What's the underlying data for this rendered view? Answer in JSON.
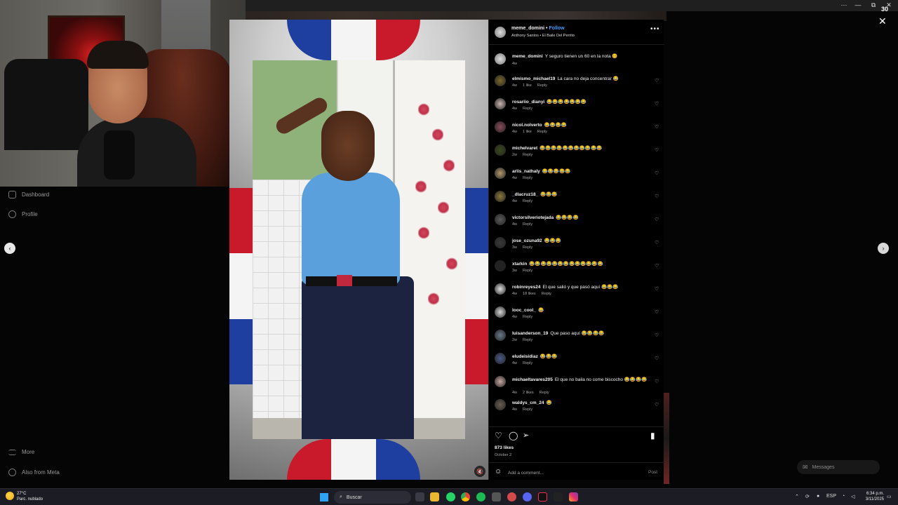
{
  "browser": {
    "controls": [
      "⋯",
      "—",
      "⧉",
      "✕"
    ],
    "counter": "30"
  },
  "sidebar": {
    "items": [
      {
        "label": "Dashboard",
        "icon": "dashboard-icon"
      },
      {
        "label": "Profile",
        "icon": "profile-icon"
      },
      {
        "label": "More",
        "icon": "menu-icon"
      },
      {
        "label": "Also from Meta",
        "icon": "meta-icon"
      }
    ]
  },
  "post": {
    "username": "meme_domini",
    "separator": "•",
    "follow_label": "Follow",
    "audio": "Anthony Santos • El Baile Del Perrito",
    "more_label": "•••",
    "caption": {
      "user": "meme_domini",
      "text": "Y seguro tienen un 60 en la nota 🥴",
      "time": "4w"
    },
    "likes": "873 likes",
    "date": "October 2",
    "add_comment_placeholder": "Add a comment...",
    "post_label": "Post",
    "mute_icon": "🔇"
  },
  "comments": [
    {
      "user": "elmismo_michael19",
      "text": "La cara no deja concentrar 😂",
      "meta": [
        "4w",
        "1 like",
        "Reply"
      ],
      "color": "#7a6a2a"
    },
    {
      "user": "rosariio_dianyi",
      "text": "😂😂😂😂😂😂😂",
      "meta": [
        "4w",
        "Reply"
      ],
      "color": "#c9b7b0"
    },
    {
      "user": "nicol.nolverto",
      "text": "😂😂😂😂",
      "meta": [
        "4w",
        "1 like",
        "Reply"
      ],
      "color": "#8a4a5a"
    },
    {
      "user": "michelvaret",
      "text": "😂😂😂😂😂😂😂😂😂😂😂",
      "meta": [
        "2w",
        "Reply"
      ],
      "color": "#3a4a1a"
    },
    {
      "user": "arlis_nathaly",
      "text": "😂😂😂😂😂",
      "meta": [
        "4w",
        "Reply"
      ],
      "color": "#b59a6a"
    },
    {
      "user": "_dlacruz18_",
      "text": "😂😂😂",
      "meta": [
        "4w",
        "Reply"
      ],
      "color": "#8a7a3a"
    },
    {
      "user": "victorsilveriotejada",
      "text": "😂😂😂😂",
      "meta": [
        "4w",
        "Reply"
      ],
      "color": "#5a5a5a"
    },
    {
      "user": "jose_ozuna92",
      "text": "😂😂😂",
      "meta": [
        "3w",
        "Reply"
      ],
      "color": "#3a3a3a"
    },
    {
      "user": "xtarkin",
      "text": "😂😂😂😂😂😂😂😂😂😂😂😂😂",
      "meta": [
        "3w",
        "Reply"
      ],
      "color": "#222222"
    },
    {
      "user": "robinreyes24",
      "text": "El que salió y que pasó aquí 😂😂😂",
      "meta": [
        "4w",
        "18 likes",
        "Reply"
      ],
      "color": "#e0e0e0"
    },
    {
      "user": "looc_cool_",
      "text": "😂",
      "meta": [
        "4w",
        "Reply"
      ],
      "color": "#d9d9d9"
    },
    {
      "user": "luisanderson_19",
      "text": "Que paso aquí 😂😂😂😂",
      "meta": [
        "2w",
        "Reply"
      ],
      "color": "#6a7a8a"
    },
    {
      "user": "eludeisidiaz",
      "text": "😂😂😂",
      "meta": [
        "4w",
        "Reply"
      ],
      "color": "#4a5a8a"
    },
    {
      "user": "michaeltavares205",
      "text": "El que no baila no come biscocho 😂😂😂😂",
      "meta": [
        "4w",
        "2 likes",
        "Reply"
      ],
      "color": "#c8a8a0"
    },
    {
      "user": "waldys_cm_24",
      "text": "😂",
      "meta": [
        "4w",
        "Reply"
      ],
      "color": "#6a6050"
    }
  ],
  "overlay": {
    "close": "✕",
    "prev": "‹",
    "next": "›"
  },
  "messages": {
    "label": "Messages"
  },
  "taskbar": {
    "weather_temp": "27°C",
    "weather_desc": "Parc. nublado",
    "search_label": "Buscar",
    "tray_lang": "ESP",
    "time": "6:34 p.m.",
    "date": "3/11/2025"
  }
}
